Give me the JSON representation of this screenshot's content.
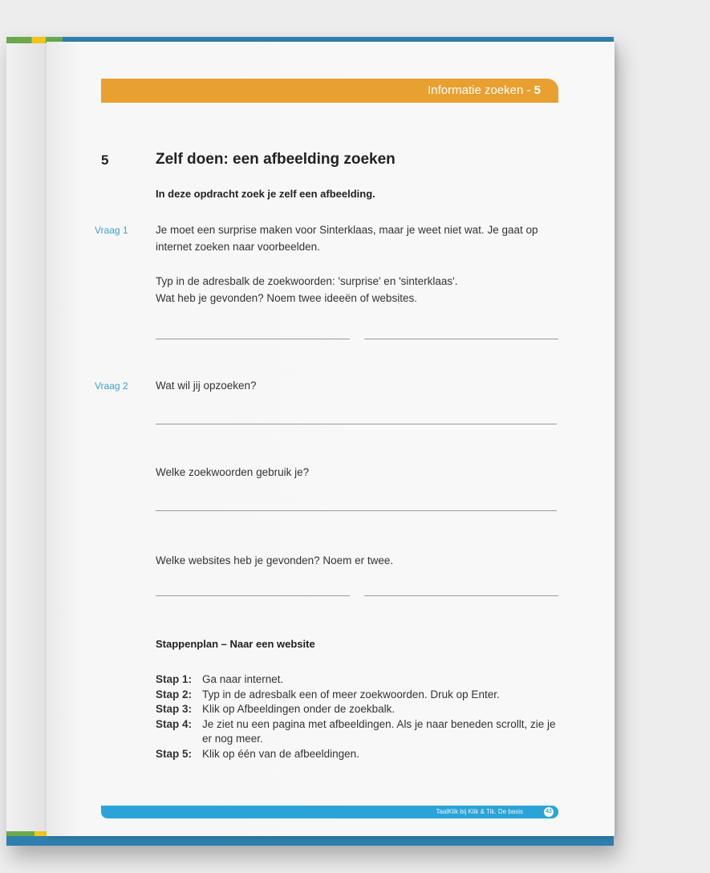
{
  "header": {
    "title": "Informatie zoeken - ",
    "number": "5"
  },
  "section": {
    "number": "5",
    "title": "Zelf doen: een afbeelding zoeken",
    "intro": "In deze opdracht zoek je zelf een afbeelding."
  },
  "vraag1": {
    "label": "Vraag 1",
    "p1": "Je moet een surprise maken voor Sinterklaas, maar je weet niet wat. Je gaat op internet zoeken naar voorbeelden.",
    "p2a": "Typ in de adresbalk de zoekwoorden: 'surprise' en 'sinterklaas'.",
    "p2b": "Wat heb je gevonden? Noem twee ideeën of websites."
  },
  "vraag2": {
    "label": "Vraag 2",
    "q1": "Wat wil jij opzoeken?",
    "q2": "Welke zoekwoorden gebruik je?",
    "q3": "Welke websites heb je gevonden? Noem er twee."
  },
  "stappenplan": {
    "title": "Stappenplan – Naar een website",
    "steps": [
      {
        "label": "Stap 1:",
        "text": "Ga naar internet."
      },
      {
        "label": "Stap 2:",
        "text": "Typ in de adresbalk een of meer zoekwoorden. Druk op Enter."
      },
      {
        "label": "Stap 3:",
        "text": "Klik op Afbeeldingen onder de zoekbalk."
      },
      {
        "label": "Stap 4:",
        "text": "Je ziet nu een pagina met afbeeldingen. Als je naar beneden scrollt, zie je er nog meer."
      },
      {
        "label": "Stap 5:",
        "text": "Klik op één van de afbeeldingen."
      }
    ]
  },
  "footer": {
    "text": "TaalKlik bij Klik & Tik. De basis",
    "page": "43"
  },
  "colors": {
    "header": "#e8a030",
    "footer": "#2aa4d8",
    "vraag": "#3aa0d0"
  }
}
